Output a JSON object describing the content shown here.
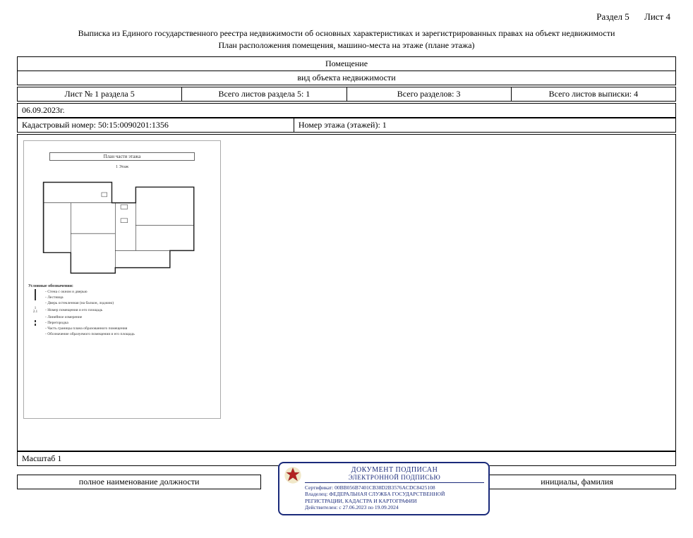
{
  "header": {
    "section_label": "Раздел 5",
    "sheet_label": "Лист 4"
  },
  "title": {
    "line1": "Выписка из Единого государственного реестра недвижимости об основных характеристиках и зарегистрированных правах на объект недвижимости",
    "line2": "План расположения помещения, машино-места на этаже (плане этажа)"
  },
  "object_header": {
    "cell1": "Помещение",
    "cell2": "вид объекта недвижимости"
  },
  "meta_row": {
    "c1": "Лист № 1 раздела 5",
    "c2": "Всего листов раздела 5: 1",
    "c3": "Всего разделов: 3",
    "c4": "Всего листов выписки: 4"
  },
  "date": "06.09.2023г.",
  "cadastral": {
    "label": "Кадастровый номер: 50:15:0090201:1356",
    "floor_label": "Номер этажа (этажей): 1"
  },
  "plan": {
    "title": "План части этажа",
    "subtitle": "1 Этаж",
    "legend_title": "Условные обозначения:",
    "legend": [
      "- Стена с окном и дверью",
      "- Лестница",
      "- Дверь остекленная (на балкон, лоджию)",
      "- Номер помещения и его площадь",
      "- Линейное измерение",
      "- Перегородка",
      "- Часть границы плана образованного помещения",
      "- Обозначение образуемого помещения и его площадь"
    ]
  },
  "scale": "Масштаб 1",
  "signature": {
    "left": "полное наименование должности",
    "right": "инициалы, фамилия"
  },
  "stamp": {
    "title1": "ДОКУМЕНТ ПОДПИСАН",
    "title2": "ЭЛЕКТРОННОЙ ПОДПИСЬЮ",
    "cert": "Сертификат: 00BB056B7401CB38D2B3576ACDC8425108",
    "owner": "Владелец: ФЕДЕРАЛЬНАЯ СЛУЖБА ГОСУДАРСТВЕННОЙ РЕГИСТРАЦИИ, КАДАСТРА И КАРТОГРАФИИ",
    "valid": "Действителен: с 27.06.2023 по 19.09.2024"
  }
}
